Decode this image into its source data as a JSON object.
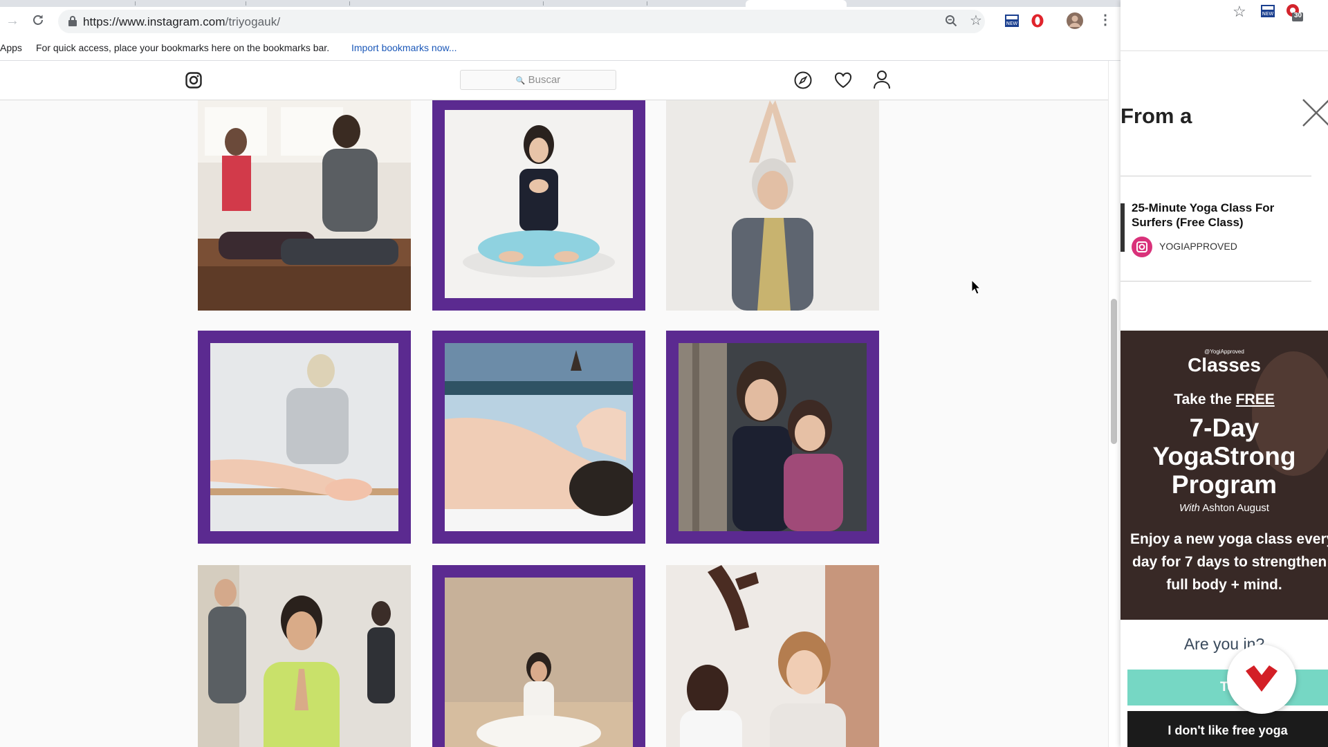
{
  "browser": {
    "url_host": "https://www.instagram.com",
    "url_path": "/triyogauk/",
    "bookmarks_apps": "Apps",
    "bookmarks_hint": "For quick access, place your bookmarks here on the bookmarks bar.",
    "bookmarks_import": "Import bookmarks now...",
    "extension_badge": "30"
  },
  "instagram": {
    "search_placeholder": "Buscar",
    "icons": [
      "instagram-logo-icon",
      "compass-icon",
      "heart-icon",
      "profile-icon"
    ],
    "posts": [
      {
        "id": 1,
        "description": "class-seated-stretch",
        "framed": false
      },
      {
        "id": 2,
        "description": "woman-cross-legged-meditation",
        "framed": true
      },
      {
        "id": 3,
        "description": "older-woman-arms-raised",
        "framed": false
      },
      {
        "id": 4,
        "description": "ballet-barre",
        "framed": true
      },
      {
        "id": 5,
        "description": "acupuncture-face",
        "framed": true
      },
      {
        "id": 6,
        "description": "two-women-portrait",
        "framed": true
      },
      {
        "id": 7,
        "description": "class-prayer-hands",
        "framed": false
      },
      {
        "id": 8,
        "description": "seated-forward-pose",
        "framed": true
      },
      {
        "id": 9,
        "description": "women-arm-raised",
        "framed": false
      }
    ]
  },
  "side_panel": {
    "heading": "From a",
    "article_title": "25-Minute Yoga Class For Surfers (Free Class)",
    "article_source": "YOGIAPPROVED",
    "promo": {
      "brand_small": "@YogiApproved",
      "brand": "Classes",
      "take_the": "Take the",
      "free": "FREE",
      "line1": "7-Day",
      "line2": "YogaStrong",
      "line3": "Program",
      "with_label": "With",
      "instructor": "Ashton August",
      "body1": "Enjoy a new yoga class every",
      "body2": "day for 7 days to strengthen",
      "body3": "full body + mind."
    },
    "question": "Are you in?",
    "cta_yes": "Tell me",
    "cta_no": "I don't like free yoga"
  }
}
